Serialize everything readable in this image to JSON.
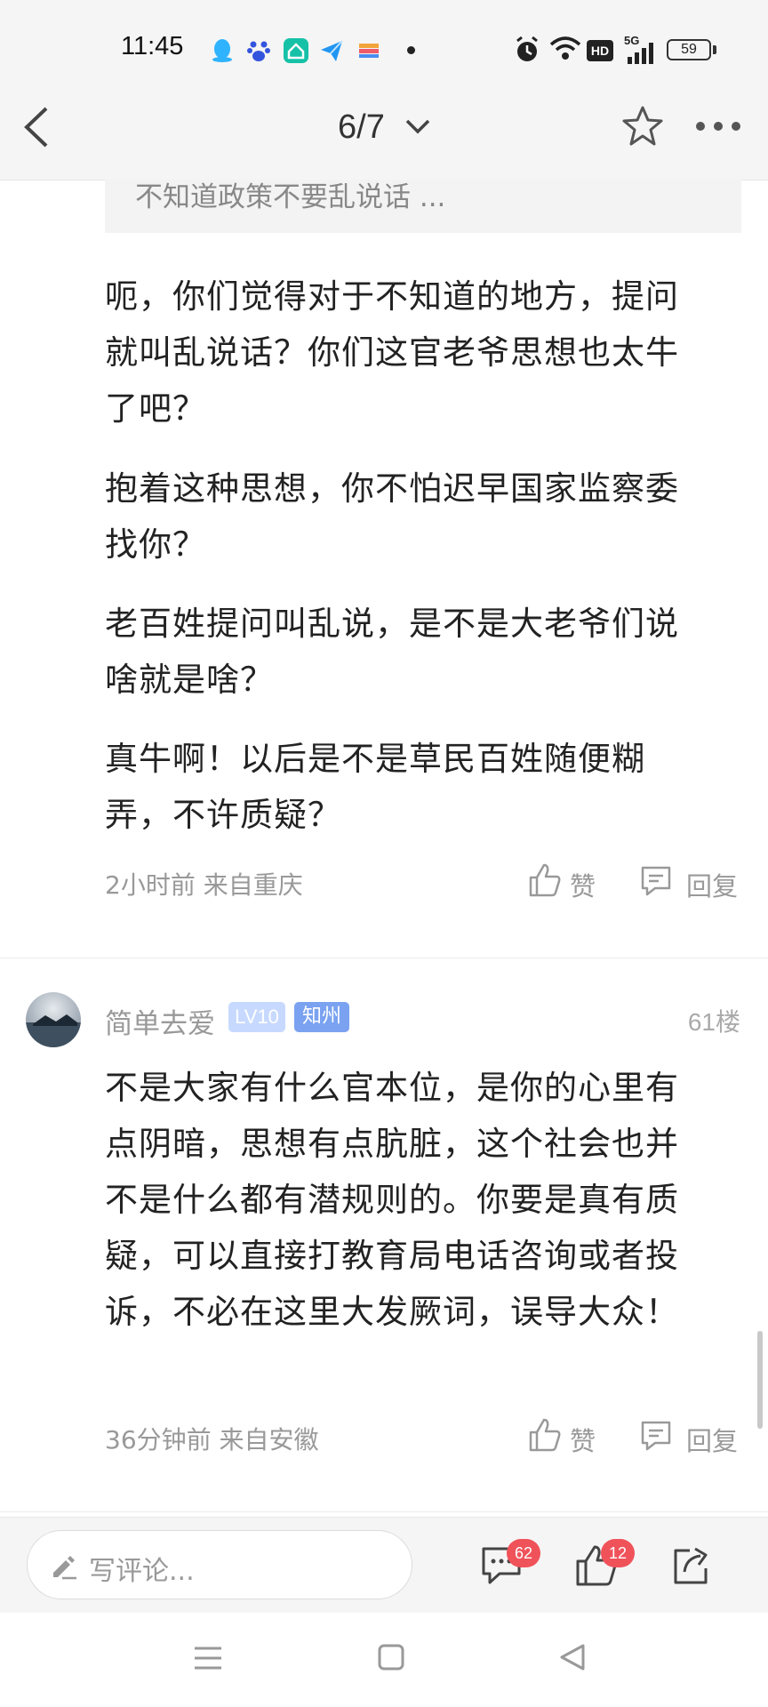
{
  "status_bar": {
    "time": "11:45",
    "notification_icons": [
      "qq-icon",
      "baidu-icon",
      "home-app-icon",
      "plane-icon",
      "card-icon"
    ],
    "system_icons": [
      "alarm-icon",
      "wifi-icon",
      "hd-icon",
      "5g-signal-icon",
      "battery-icon"
    ],
    "network_label": "5G",
    "hd_label": "HD",
    "battery_level": "59"
  },
  "header": {
    "page_indicator": "6/7",
    "back_icon": "back-icon",
    "dropdown_icon": "chevron-down-icon",
    "favorite_icon": "star-icon",
    "more_icon": "more-icon"
  },
  "quote": {
    "text": "不知道政策不要乱说话 ..."
  },
  "reply_60": {
    "paragraphs": [
      "呃，你们觉得对于不知道的地方，提问就叫乱说话？你们这官老爷思想也太牛了吧？",
      "抱着这种思想，你不怕迟早国家监察委找你？",
      "老百姓提问叫乱说，是不是大老爷们说啥就是啥？",
      "真牛啊！以后是不是草民百姓随便糊弄，不许质疑？"
    ],
    "meta": "2小时前 来自重庆",
    "like_label": "赞",
    "reply_label": "回复"
  },
  "reply_61": {
    "username": "简单去爱",
    "level": "LV10",
    "tag": "知州",
    "floor": "61楼",
    "content": "不是大家有什么官本位，是你的心里有点阴暗，思想有点肮脏，这个社会也并不是什么都有潜规则的。你要是真有质疑，可以直接打教育局电话咨询或者投诉，不必在这里大发厥词，误导大众！",
    "meta": "36分钟前 来自安徽",
    "like_label": "赞",
    "reply_label": "回复"
  },
  "bottom_bar": {
    "comment_placeholder": "写评论...",
    "comment_count": "62",
    "like_count": "12"
  },
  "colors": {
    "badge_red": "#f0525a",
    "level_badge": "#c7d9ff",
    "tag_badge": "#7aa2f0",
    "text_main": "#222222",
    "text_meta": "#999999"
  }
}
